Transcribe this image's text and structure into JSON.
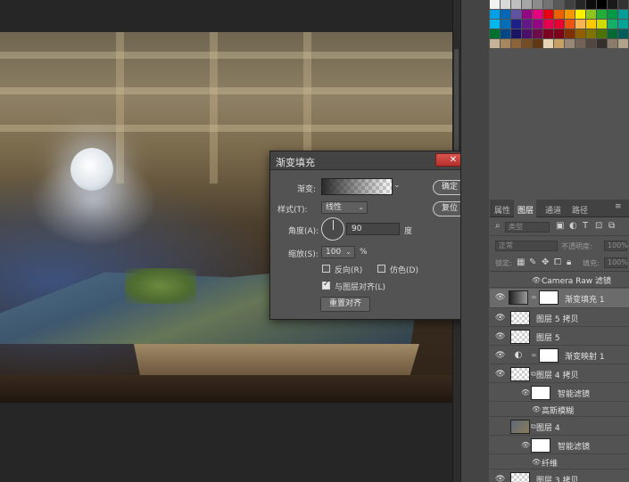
{
  "dialog": {
    "title": "渐变填充",
    "close_label": "✕",
    "gradient_label": "渐变:",
    "style_label": "样式(T):",
    "style_value": "线性",
    "angle_label": "角度(A):",
    "angle_value": "90",
    "angle_unit": "度",
    "scale_label": "缩放(S):",
    "scale_value": "100",
    "scale_unit": "%",
    "reverse_label": "反向(R)",
    "reverse_checked": false,
    "dither_label": "仿色(D)",
    "dither_checked": false,
    "align_label": "与图层对齐(L)",
    "align_checked": true,
    "reset_align_label": "重置对齐",
    "ok_label": "确定",
    "reset_label": "复位"
  },
  "swatches": [
    "#f2f2f2",
    "#d9d9d9",
    "#bfbfbf",
    "#a6a6a6",
    "#8c8c8c",
    "#737373",
    "#595959",
    "#404040",
    "#262626",
    "#0d0d0d",
    "#000000",
    "#1a1a1a",
    "#333333",
    "#00a0e9",
    "#0068b7",
    "#5f52a0",
    "#920783",
    "#e4007f",
    "#e60012",
    "#eb6100",
    "#f39800",
    "#fff100",
    "#8fc31f",
    "#22ac38",
    "#009944",
    "#009e96",
    "#00b7ee",
    "#036eb8",
    "#1d2088",
    "#601986",
    "#920783",
    "#e5004f",
    "#e60033",
    "#ea5514",
    "#f8b551",
    "#fcc800",
    "#cfdb00",
    "#13ae67",
    "#00a497",
    "#007130",
    "#004986",
    "#1b1464",
    "#4c0f6c",
    "#6d0c4a",
    "#7d0022",
    "#7f0019",
    "#7f2f00",
    "#8f5f00",
    "#7f7400",
    "#4c7200",
    "#006934",
    "#005e5a",
    "#c7b299",
    "#a6875f",
    "#8c6239",
    "#754c24",
    "#603813",
    "#e6d3b3",
    "#c9a063",
    "#998675",
    "#736357",
    "#534741",
    "#362f2d",
    "#8c7b68",
    "#b3a28b"
  ],
  "layers_panel": {
    "tabs": [
      "属性",
      "图层",
      "通道",
      "路径"
    ],
    "active_tab": "图层",
    "filter_placeholder": "类型",
    "blend_mode": "正常",
    "opacity_label": "不透明度:",
    "opacity_value": "100%",
    "lock_label": "锁定:",
    "fill_label": "填充:",
    "fill_value": "100%",
    "layers": [
      {
        "name": "Camera Raw 滤镜",
        "type": "filter",
        "visible": true
      },
      {
        "name": "渐变填充 1",
        "type": "gradient-fill",
        "visible": true,
        "selected": true
      },
      {
        "name": "图层 5 拷贝",
        "type": "pixel",
        "visible": true
      },
      {
        "name": "图层 5",
        "type": "pixel",
        "visible": true
      },
      {
        "name": "渐变映射 1",
        "type": "adjustment",
        "visible": true
      },
      {
        "name": "图层 4 拷贝",
        "type": "smart",
        "visible": true
      },
      {
        "name": "智能滤镜",
        "type": "smart-filter-mask",
        "visible": true
      },
      {
        "name": "高斯模糊",
        "type": "filter",
        "visible": true
      },
      {
        "name": "图层 4",
        "type": "smart",
        "visible": false
      },
      {
        "name": "智能滤镜",
        "type": "smart-filter-mask",
        "visible": true
      },
      {
        "name": "纤维",
        "type": "filter",
        "visible": true
      },
      {
        "name": "图层 3 拷贝",
        "type": "pixel",
        "visible": true
      }
    ]
  }
}
